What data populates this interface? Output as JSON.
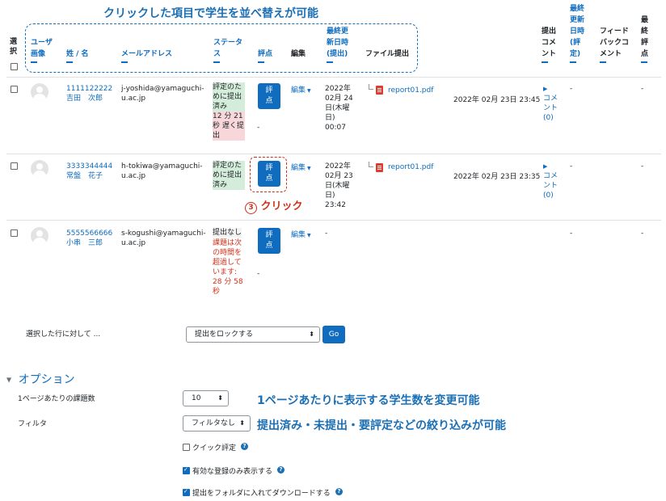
{
  "annotations": {
    "sort_hint": "クリックした項目で学生を並べ替えが可能",
    "click_num": "3",
    "click_label": "クリック",
    "per_page_hint": "1ページあたりに表示する学生数を変更可能",
    "filter_hint": "提出済み・未提出・要評定などの絞り込みが可能"
  },
  "headers": {
    "select": "選\n択",
    "user_image": "ユーザ\n画像",
    "name": "姓 / 名",
    "email": "メールアドレス",
    "status": "ステータ\nス",
    "grade": "評点",
    "edit": "編集",
    "last_modified": "最終更\n新日時\n(提出)",
    "file_submission": "ファイル提出",
    "submission_comment": "提出\nコメ\nント",
    "last_modified_grade": "最終\n更新\n日時\n(評\n定)",
    "feedback_comment": "フィード\nバックコ\nメント",
    "final_grade": "最\n終\n評\n点"
  },
  "rows": [
    {
      "id": "1111122222",
      "name": "吉田　次郎",
      "email": "j-yoshida@yamaguchi-\nu.ac.jp",
      "status": "評定のた\nめに提出\n済み",
      "late": "12 分 21\n秒 遅く提\n出",
      "grade_button": "評\n点",
      "grade_value": "-",
      "edit": "編集",
      "modified": "2022年\n02月 24\n日(木曜\n日)\n00:07",
      "file": "report01.pdf",
      "file_date": "2022年 02月 23日 23:45",
      "comment": "コメ\nント\n(0)",
      "grade_modified": "-",
      "final": "-"
    },
    {
      "id": "3333344444",
      "name": "常盤　花子",
      "email": "h-tokiwa@yamaguchi-\nu.ac.jp",
      "status": "評定のた\nめに提出\n済み",
      "grade_button": "評\n点",
      "edit": "編集",
      "modified": "2022年\n02月 23\n日(木曜\n日)\n23:42",
      "file": "report01.pdf",
      "file_date": "2022年 02月 23日 23:35",
      "comment": "コメ\nント\n(0)",
      "grade_modified": "-",
      "final": "-"
    },
    {
      "id": "5555566666",
      "name": "小串　三郎",
      "email": "s-kogushi@yamaguchi-\nu.ac.jp",
      "status": "提出なし",
      "late": "課題は次\nの時間を\n超過して\nいます:\n28 分 58\n秒",
      "grade_button": "評\n点",
      "grade_value": "-",
      "edit": "編集",
      "modified": "-",
      "grade_modified": "-",
      "final": "-"
    }
  ],
  "bulk": {
    "label": "選択した行に対して ...",
    "selected": "提出をロックする",
    "go": "Go"
  },
  "options": {
    "title": "オプション",
    "per_page_label": "1ページあたりの課題数",
    "per_page_value": "10",
    "filter_label": "フィルタ",
    "filter_value": "フィルタなし",
    "quick_grade": "クイック評定",
    "quick_grade_checked": false,
    "only_active": "有効な登録のみ表示する",
    "only_active_checked": true,
    "download_folders": "提出をフォルダに入れてダウンロードする",
    "download_folders_checked": true
  },
  "colors": {
    "accent": "#0f6cbf",
    "annotation": "#1a6fb5",
    "late": "#d12f19",
    "submitted_bg": "#d4edda",
    "late_bg": "#f8d7da"
  }
}
